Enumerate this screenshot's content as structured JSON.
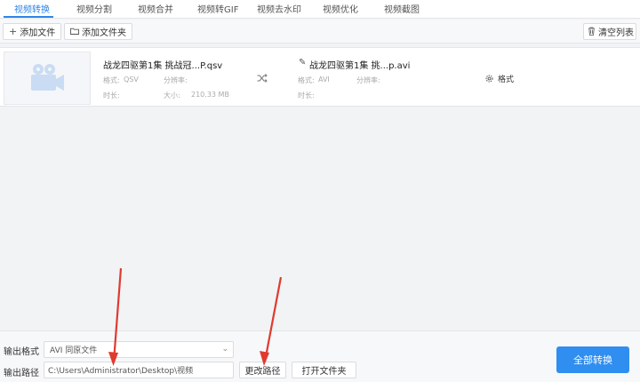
{
  "tabs": [
    {
      "label": "视频转换",
      "active": true
    },
    {
      "label": "视频分割"
    },
    {
      "label": "视频合并"
    },
    {
      "label": "视频转GIF"
    },
    {
      "label": "视频去水印"
    },
    {
      "label": "视频优化"
    },
    {
      "label": "视频截图"
    }
  ],
  "toolbar": {
    "add_file": "添加文件",
    "add_folder": "添加文件夹",
    "clear_list": "清空列表"
  },
  "file": {
    "source_name": "战龙四驱第1集 挑战冠...P.qsv",
    "source_format_label": "格式:",
    "source_format": "QSV",
    "source_resolution_label": "分辨率:",
    "source_duration_label": "时长:",
    "source_size_label": "大小:",
    "source_size": "210.33 MB",
    "target_name": "战龙四驱第1集 挑...p.avi",
    "target_format_label": "格式:",
    "target_format": "AVI",
    "target_resolution_label": "分辨率:",
    "target_duration_label": "时长:",
    "format_button": "格式"
  },
  "bottom": {
    "output_format_label": "输出格式",
    "output_format_value": "AVI  同原文件",
    "output_path_label": "输出路径",
    "output_path_value": "C:\\Users\\Administrator\\Desktop\\视频",
    "change_path": "更改路径",
    "open_folder": "打开文件夹",
    "convert_all": "全部转换"
  },
  "colors": {
    "accent": "#2f86e8",
    "button_primary": "#2f8ef0",
    "annotation_arrow": "#e03a2f"
  },
  "icons": [
    "plus-icon",
    "folder-icon",
    "trash-icon",
    "video-camera-icon",
    "shuffle-arrows-icon",
    "pencil-icon",
    "gear-icon",
    "chevron-down-icon"
  ]
}
